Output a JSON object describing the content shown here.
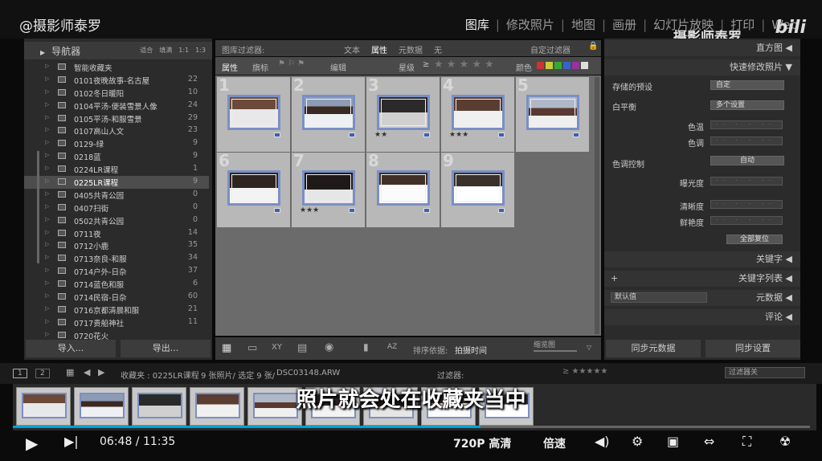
{
  "header": {
    "channel": "@摄影师泰罗",
    "modules": [
      "图库",
      "修改照片",
      "地图",
      "画册",
      "幻灯片放映",
      "打印",
      "Web"
    ],
    "active_module": "图库",
    "watermark": "摄影师泰罗",
    "platform": "bilibili"
  },
  "left_panel": {
    "navigator_title": "导航器",
    "navigator_options": [
      "适合",
      "填满",
      "1:1",
      "1:3"
    ],
    "collections": [
      {
        "name": "智能收藏夹",
        "count": ""
      },
      {
        "name": "0101夜晚故事-名古屋",
        "count": "22"
      },
      {
        "name": "0102冬日暖阳",
        "count": "10"
      },
      {
        "name": "0104平汤-便装雪景人像",
        "count": "24"
      },
      {
        "name": "0105平汤-和服雪景",
        "count": "29"
      },
      {
        "name": "0107高山人文",
        "count": "23"
      },
      {
        "name": "0129-绿",
        "count": "9"
      },
      {
        "name": "0218蓝",
        "count": "9"
      },
      {
        "name": "0224LR课程",
        "count": "1"
      },
      {
        "name": "0225LR课程",
        "count": "9"
      },
      {
        "name": "0405共青公园",
        "count": "0"
      },
      {
        "name": "0407扫街",
        "count": "0"
      },
      {
        "name": "0502共青公园",
        "count": "0"
      },
      {
        "name": "0711夜",
        "count": "14"
      },
      {
        "name": "0712小鹿",
        "count": "35"
      },
      {
        "name": "0713奈良-和服",
        "count": "34"
      },
      {
        "name": "0714户外-日杂",
        "count": "37"
      },
      {
        "name": "0714蓝色和服",
        "count": "6"
      },
      {
        "name": "0714民宿-日杂",
        "count": "60"
      },
      {
        "name": "0716京都清晨和服",
        "count": "21"
      },
      {
        "name": "0717贵船神社",
        "count": "11"
      },
      {
        "name": "0720花火",
        "count": ""
      }
    ],
    "selected_index": 9,
    "import_label": "导入...",
    "export_label": "导出..."
  },
  "filter_bar": {
    "title": "图库过滤器:",
    "tabs": [
      "文本",
      "属性",
      "元数据",
      "无"
    ],
    "active_tab": "属性",
    "preset": "自定过滤器",
    "attr_label": "属性",
    "flag_label": "旗标",
    "edit_label": "编辑",
    "rating_label": "星级",
    "rating_op": "≥",
    "color_label": "颜色"
  },
  "grid": {
    "cells": [
      {
        "num": "1",
        "stars": "",
        "style": "p1"
      },
      {
        "num": "2",
        "stars": "",
        "style": "p2"
      },
      {
        "num": "3",
        "stars": "★★",
        "style": "p3"
      },
      {
        "num": "4",
        "stars": "★★★",
        "style": "p4"
      },
      {
        "num": "5",
        "stars": "",
        "style": "p5"
      },
      {
        "num": "6",
        "stars": "",
        "style": "p6"
      },
      {
        "num": "7",
        "stars": "★★★",
        "style": "p7"
      },
      {
        "num": "8",
        "stars": "",
        "style": "p8"
      },
      {
        "num": "9",
        "stars": "",
        "style": "p9"
      }
    ]
  },
  "toolbar": {
    "sort_label": "排序依据:",
    "sort_value": "拍摄时间",
    "thumb_label": "缩览图"
  },
  "right_panel": {
    "histogram": "直方图",
    "quick_develop": "快速修改照片",
    "saved_preset_label": "存储的预设",
    "saved_preset_value": "自定",
    "white_balance_label": "白平衡",
    "white_balance_value": "多个设置",
    "temp_label": "色温",
    "tint_label": "色调",
    "tone_label": "色调控制",
    "auto_label": "自动",
    "exposure_label": "曝光度",
    "clarity_label": "清晰度",
    "vibrance_label": "鲜艳度",
    "reset_label": "全部复位",
    "keywords": "关键字",
    "keyword_list": "关键字列表",
    "metadata": "元数据",
    "metadata_preset": "默认值",
    "comments": "评论",
    "sync_meta": "同步元数据",
    "sync_settings": "同步设置"
  },
  "filmstrip": {
    "pages": [
      "1",
      "2"
    ],
    "path": "收藏夹 : 0225LR课程",
    "count": "9 张照片/ 选定 9 张/",
    "file": "DSC03148.ARW",
    "filter_label": "过滤器:",
    "filter_value": "过滤器关"
  },
  "subtitle": "照片就会处在收藏夹当中",
  "player": {
    "time": "06:48 / 11:35",
    "quality": "720P 高清",
    "speed": "倍速",
    "progress": 0.587
  }
}
